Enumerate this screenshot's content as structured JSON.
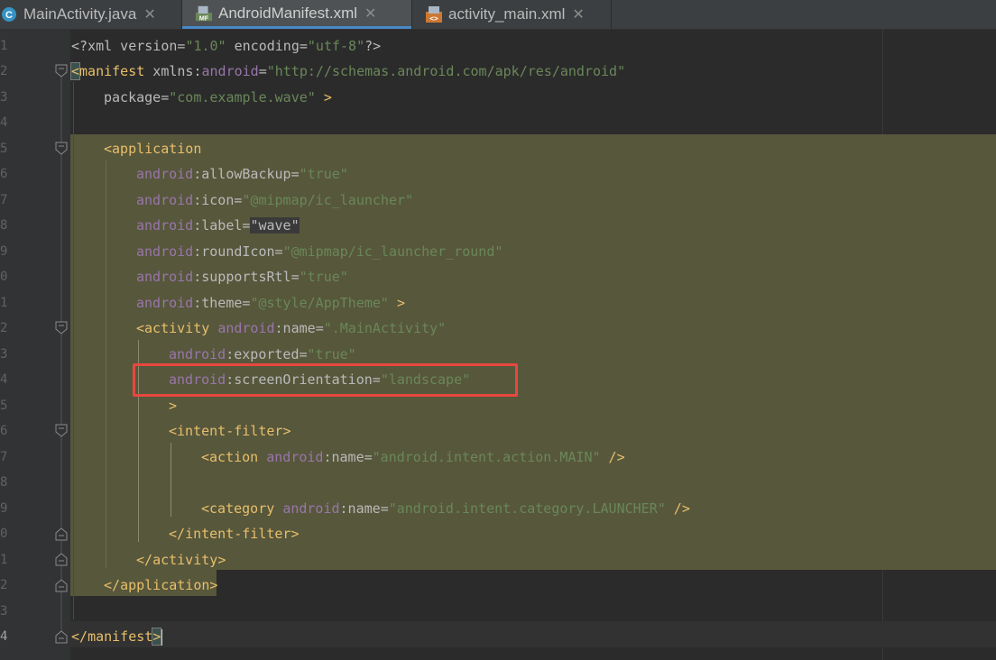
{
  "tabs": [
    {
      "label": "MainActivity.java",
      "icon": "class-c-icon",
      "active": false
    },
    {
      "label": "AndroidManifest.xml",
      "icon": "manifest-icon",
      "icon_text": "MF",
      "active": true
    },
    {
      "label": "activity_main.xml",
      "icon": "layout-xml-icon",
      "active": false
    }
  ],
  "close_glyph": "✕",
  "line_numbers": [
    "1",
    "2",
    "3",
    "4",
    "5",
    "6",
    "7",
    "8",
    "9",
    "0",
    "1",
    "2",
    "3",
    "4",
    "5",
    "6",
    "7",
    "8",
    "9",
    "0",
    "1",
    "2",
    "3",
    "4"
  ],
  "code": {
    "l1": {
      "pre": "<?xml version=",
      "v1": "\"1.0\"",
      "mid": " encoding=",
      "v2": "\"utf-8\"",
      "end": "?>"
    },
    "l2": {
      "open": "<",
      "tag": "manifest",
      "sp": " xmlns:",
      "ns": "android",
      "eq": "=",
      "val": "\"http://schemas.android.com/apk/res/android\""
    },
    "l3": {
      "attr": "package",
      "eq": "=",
      "val": "\"com.example.wave\"",
      "end": " >"
    },
    "l5": {
      "open": "<",
      "tag": "application"
    },
    "l6": {
      "ns": "android",
      "attr": ":allowBackup",
      "eq": "=",
      "val": "\"true\""
    },
    "l7": {
      "ns": "android",
      "attr": ":icon",
      "eq": "=",
      "val": "\"@mipmap/ic_launcher\""
    },
    "l8": {
      "ns": "android",
      "attr": ":label",
      "eq": "=",
      "val": "\"wave\""
    },
    "l9": {
      "ns": "android",
      "attr": ":roundIcon",
      "eq": "=",
      "val": "\"@mipmap/ic_launcher_round\""
    },
    "l10": {
      "ns": "android",
      "attr": ":supportsRtl",
      "eq": "=",
      "val": "\"true\""
    },
    "l11": {
      "ns": "android",
      "attr": ":theme",
      "eq": "=",
      "val": "\"@style/AppTheme\"",
      "end": " >"
    },
    "l12": {
      "open": "<",
      "tag": "activity",
      "sp": " ",
      "ns": "android",
      "attr": ":name",
      "eq": "=",
      "val": "\".MainActivity\""
    },
    "l13": {
      "ns": "android",
      "attr": ":exported",
      "eq": "=",
      "val": "\"true\""
    },
    "l14": {
      "ns": "android",
      "attr": ":screenOrientation",
      "eq": "=",
      "val": "\"landscape\""
    },
    "l15": {
      "end": ">"
    },
    "l16": {
      "open": "<",
      "tag": "intent-filter",
      "close": ">"
    },
    "l17": {
      "open": "<",
      "tag": "action",
      "sp": " ",
      "ns": "android",
      "attr": ":name",
      "eq": "=",
      "val": "\"android.intent.action.MAIN\"",
      "end": " />"
    },
    "l19": {
      "open": "<",
      "tag": "category",
      "sp": " ",
      "ns": "android",
      "attr": ":name",
      "eq": "=",
      "val": "\"android.intent.category.LAUNCHER\"",
      "end": " />"
    },
    "l20": {
      "open": "</",
      "tag": "intent-filter",
      "close": ">"
    },
    "l21": {
      "open": "</",
      "tag": "activity",
      "close": ">"
    },
    "l22": {
      "open": "</",
      "tag": "application",
      "close": ">"
    },
    "l24": {
      "open": "</",
      "tag": "manifest",
      "close": ">"
    }
  },
  "colors": {
    "tag": "#e8bf6a",
    "namespace": "#9876aa",
    "attribute": "#bababa",
    "value": "#6a8759",
    "selection": "#57573c",
    "annotation_box": "#e9473f",
    "active_tab_underline": "#4a88c7"
  }
}
